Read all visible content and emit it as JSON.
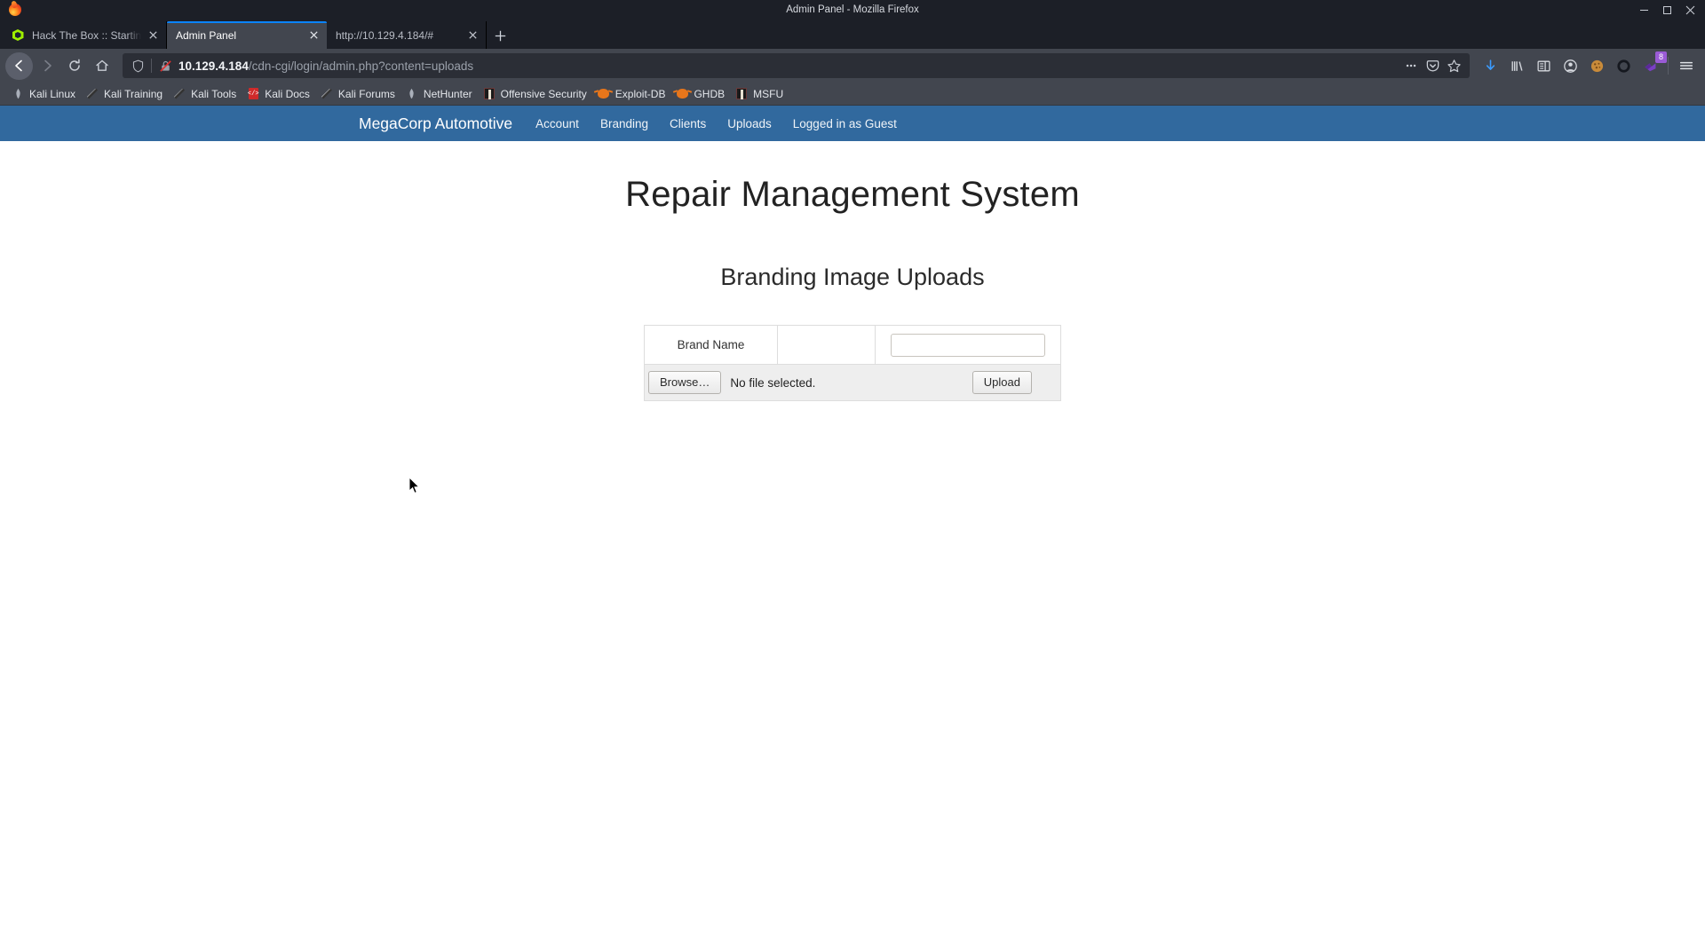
{
  "window": {
    "title": "Admin Panel - Mozilla Firefox",
    "minimize": "—",
    "maximize": "▢",
    "close": "✕"
  },
  "tabs": [
    {
      "title": "Hack The Box :: Starting P",
      "favicon": "htb-icon",
      "active": false,
      "close": "✕"
    },
    {
      "title": "Admin Panel",
      "favicon": "none",
      "active": true,
      "close": "✕"
    },
    {
      "title": "http://10.129.4.184/#",
      "favicon": "none",
      "active": false,
      "close": "✕"
    }
  ],
  "newtab_label": "+",
  "toolbar": {
    "back": "←",
    "forward": "→",
    "reload": "⟳",
    "home": "⌂",
    "url_host": "10.129.4.184",
    "url_path": "/cdn-cgi/login/admin.php?content=uploads",
    "url_full": "10.129.4.184/cdn-cgi/login/admin.php?content=uploads",
    "shield_icon": "tracking-protection-shield",
    "lock_icon": "insecure-connection-crossed-lock",
    "page_actions": "…",
    "pocket_icon": "save-to-pocket",
    "bookmark_icon": "★",
    "downloads_icon": "downloads-arrow",
    "library_icon": "library",
    "sidebar_icon": "sidebar",
    "account_icon": "account",
    "cookie_icon": "cookie-manager",
    "circle_icon": "extension-circle",
    "extension_icon": "extension-purple",
    "extension_badge": "8",
    "menu_icon": "≡"
  },
  "bookmarks": [
    {
      "label": "Kali Linux",
      "icon": "dragon-icon"
    },
    {
      "label": "Kali Training",
      "icon": "pencil-icon"
    },
    {
      "label": "Kali Tools",
      "icon": "pencil-icon"
    },
    {
      "label": "Kali Docs",
      "icon": "book-icon"
    },
    {
      "label": "Kali Forums",
      "icon": "pencil-icon"
    },
    {
      "label": "NetHunter",
      "icon": "dragon-icon"
    },
    {
      "label": "Offensive Security",
      "icon": "offsec-icon"
    },
    {
      "label": "Exploit-DB",
      "icon": "bug-icon"
    },
    {
      "label": "GHDB",
      "icon": "bug-icon"
    },
    {
      "label": "MSFU",
      "icon": "offsec-icon"
    }
  ],
  "site": {
    "brand": "MegaCorp Automotive",
    "nav": [
      {
        "label": "Account"
      },
      {
        "label": "Branding"
      },
      {
        "label": "Clients"
      },
      {
        "label": "Uploads"
      },
      {
        "label": "Logged in as Guest"
      }
    ],
    "accent_color": "#31699e"
  },
  "main": {
    "page_title": "Repair Management System",
    "section_title": "Branding Image Uploads",
    "form": {
      "brand_name_label": "Brand Name",
      "brand_name_value": "",
      "brand_name_placeholder": "",
      "browse_button": "Browse…",
      "file_status": "No file selected.",
      "upload_button": "Upload"
    }
  }
}
